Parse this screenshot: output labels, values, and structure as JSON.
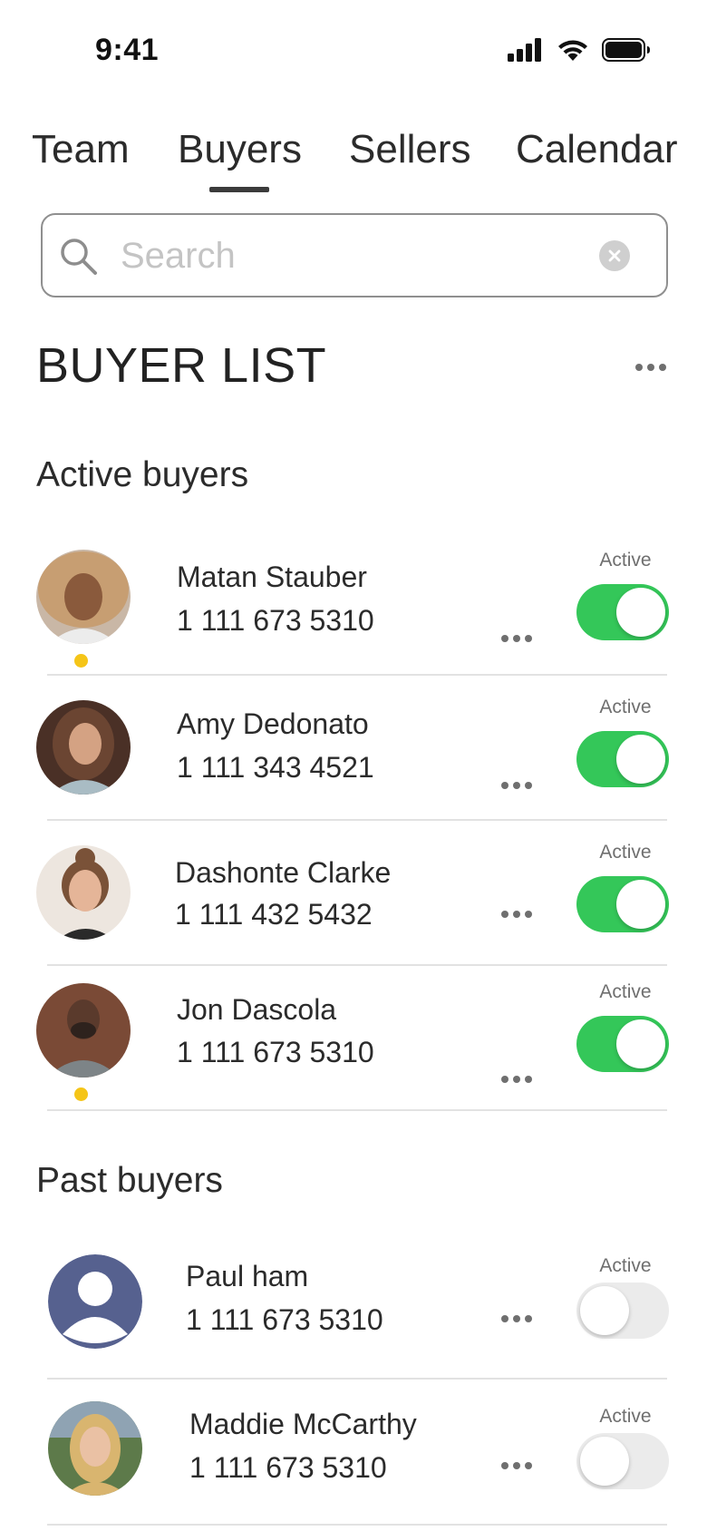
{
  "status_bar": {
    "time": "9:41"
  },
  "tabs": [
    {
      "label": "Team"
    },
    {
      "label": "Buyers",
      "selected": true
    },
    {
      "label": "Sellers"
    },
    {
      "label": "Calendar"
    }
  ],
  "search": {
    "placeholder": "Search",
    "value": ""
  },
  "page_title": "BUYER LIST",
  "sections": {
    "active": {
      "title": "Active buyers",
      "buyers": [
        {
          "name": "Matan Stauber",
          "phone": "1 111 673 5310",
          "status_label": "Active",
          "active": true,
          "presence_dot": true
        },
        {
          "name": "Amy Dedonato",
          "phone": "1 111 343 4521",
          "status_label": "Active",
          "active": true,
          "presence_dot": false
        },
        {
          "name": "Dashonte Clarke",
          "phone": "1 111 432 5432",
          "status_label": "Active",
          "active": true,
          "presence_dot": false
        },
        {
          "name": "Jon Dascola",
          "phone": "1 111 673 5310",
          "status_label": "Active",
          "active": true,
          "presence_dot": true
        }
      ]
    },
    "past": {
      "title": "Past buyers",
      "buyers": [
        {
          "name": "Paul ham",
          "phone": "1 111 673 5310",
          "status_label": "Active",
          "active": false,
          "presence_dot": false
        },
        {
          "name": "Maddie McCarthy",
          "phone": "1 111 673 5310",
          "status_label": "Active",
          "active": false,
          "presence_dot": false
        }
      ]
    }
  },
  "colors": {
    "toggle_on": "#34c759",
    "toggle_off": "#ebebeb",
    "presence_dot": "#f5c518",
    "placeholder_avatar": "#56618f"
  },
  "icons": {
    "search": "search-icon",
    "clear": "clear-icon",
    "more": "more-horizontal-icon",
    "signal": "cellular-signal-icon",
    "wifi": "wifi-icon",
    "battery": "battery-icon",
    "placeholder_avatar": "user-placeholder-icon"
  }
}
